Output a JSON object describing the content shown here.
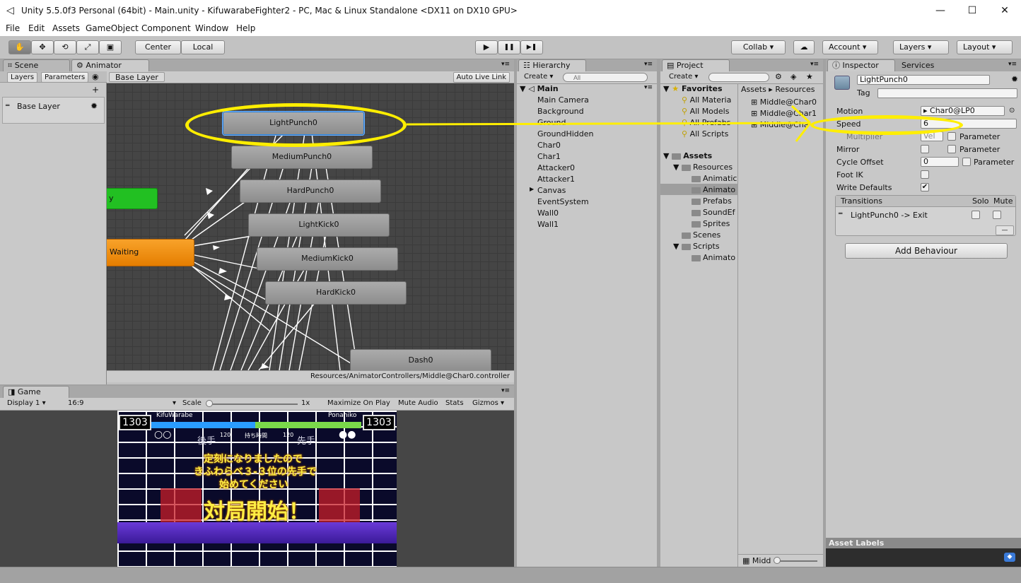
{
  "window": {
    "title": "Unity 5.5.0f3 Personal (64bit) - Main.unity - KifuwarabeFighter2 - PC, Mac & Linux Standalone <DX11 on DX10 GPU>",
    "minimize": "—",
    "maximize": "☐",
    "close": "✕"
  },
  "menu": [
    "File",
    "Edit",
    "Assets",
    "GameObject",
    "Component",
    "Window",
    "Help"
  ],
  "toolbar": {
    "tools": [
      "✋",
      "✥",
      "⟲",
      "⤢",
      "▣"
    ],
    "center": "Center",
    "local": "Local",
    "play": "▶",
    "pause": "❚❚",
    "step": "▶❚",
    "collab": "Collab",
    "cloud": "☁",
    "account": "Account",
    "layers": "Layers",
    "layout": "Layout"
  },
  "animator": {
    "tab_scene": "Scene",
    "tab_animator": "Animator",
    "sub_layers": "Layers",
    "sub_parameters": "Parameters",
    "plus": "+",
    "layer_name": "Base Layer",
    "breadcrumb": "Base Layer",
    "auto_live_link": "Auto Live Link",
    "states": [
      "LightPunch0",
      "MediumPunch0",
      "HardPunch0",
      "LightKick0",
      "MediumKick0",
      "HardKick0",
      "Dash0"
    ],
    "entry_state": "y",
    "waiting_state": "Waiting",
    "path": "Resources/AnimatorControllers/Middle@Char0.controller"
  },
  "hierarchy": {
    "tab": "Hierarchy",
    "create": "Create",
    "search_placeholder": "All",
    "scene": "Main",
    "items": [
      "Main Camera",
      "Background",
      "Ground",
      "GroundHidden",
      "Char0",
      "Char1",
      "Attacker0",
      "Attacker1",
      "Canvas",
      "EventSystem",
      "Wall0",
      "Wall1"
    ]
  },
  "project": {
    "tab": "Project",
    "create": "Create",
    "favorites": "Favorites",
    "fav_items": [
      "All Materia",
      "All Models",
      "All Prefabs",
      "All Scripts"
    ],
    "assets": "Assets",
    "tree": [
      "Resources",
      "Animatic",
      "Animato",
      "Prefabs",
      "SoundEf",
      "Sprites",
      "Scenes",
      "Scripts",
      "Animato"
    ],
    "breadcrumb_1": "Assets",
    "breadcrumb_2": "Resources",
    "files": [
      "Middle@Char0",
      "Middle@Char1",
      "Middle@Cha"
    ],
    "bottom_label": "Midd"
  },
  "inspector": {
    "tab": "Inspector",
    "tab_services": "Services",
    "name": "LightPunch0",
    "tag_label": "Tag",
    "motion_label": "Motion",
    "motion_value": "Char0@LP0",
    "speed_label": "Speed",
    "speed_value": "6",
    "multiplier_label": "Multiplier",
    "multiplier_value": "Vel",
    "mirror_label": "Mirror",
    "cycle_label": "Cycle Offset",
    "cycle_value": "0",
    "footik_label": "Foot IK",
    "writedef_label": "Write Defaults",
    "parameter": "Parameter",
    "transitions_label": "Transitions",
    "solo": "Solo",
    "mute": "Mute",
    "transition_item": "LightPunch0 -> Exit",
    "minus": "—",
    "add_behaviour": "Add Behaviour",
    "asset_labels": "Asset Labels",
    "checkmark": "✔"
  },
  "game": {
    "tab": "Game",
    "display": "Display 1",
    "aspect": "16:9",
    "scale": "Scale",
    "scale_value": "1x",
    "maximize": "Maximize On Play",
    "mute": "Mute Audio",
    "stats": "Stats",
    "gizmos": "Gizmos",
    "hud": {
      "score_left": "1303",
      "score_right": "1303",
      "name_left": "KifuWarabe",
      "name_right": "Ponahiko",
      "gote": "後手",
      "sente": "先手",
      "time_left": "120",
      "time_right": "120",
      "time_label": "持ち時間",
      "message_line1": "定刻になりましたので",
      "message_line2": "きふわらべ３-３位の先手で",
      "message_line3": "始めてください",
      "start": "対局開始！"
    }
  },
  "colors": {
    "highlight": "#ffee00",
    "waiting": "#f08a00",
    "entry": "#22c022",
    "hp_left": "#2a9cff",
    "hp_right": "#7ad84a"
  }
}
